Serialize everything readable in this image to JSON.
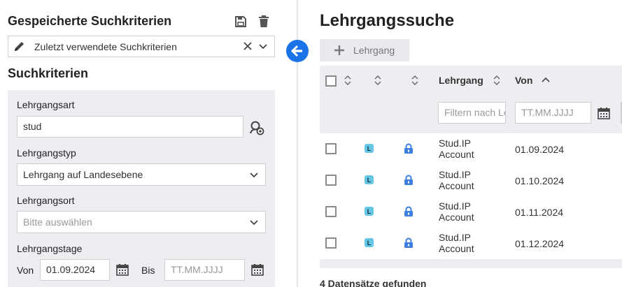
{
  "saved": {
    "title": "Gespeicherte Suchkriterien",
    "selected": "Zuletzt verwendete Suchkriterien"
  },
  "criteria": {
    "title": "Suchkriterien",
    "art_label": "Lehrgangsart",
    "art_value": "stud",
    "typ_label": "Lehrgangstyp",
    "typ_value": "Lehrgang auf Landesebene",
    "ort_label": "Lehrgangsort",
    "ort_placeholder": "Bitte auswählen",
    "tage_label": "Lehrgangstage",
    "von_label": "Von",
    "von_value": "01.09.2024",
    "bis_label": "Bis",
    "bis_placeholder": "TT.MM.JJJJ"
  },
  "main": {
    "title": "Lehrgangssuche",
    "add_label": "Lehrgang"
  },
  "table": {
    "col_lehrgang": "Lehrgang",
    "col_von": "Von",
    "filter_lehrgang_placeholder": "Filtern nach Lehrgang",
    "filter_von_placeholder": "TT.MM.JJJJ",
    "badge": "L",
    "rows": [
      {
        "lehrgang_line1": "Stud.IP",
        "lehrgang_line2": "Account",
        "von": "01.09.2024"
      },
      {
        "lehrgang_line1": "Stud.IP",
        "lehrgang_line2": "Account",
        "von": "01.10.2024"
      },
      {
        "lehrgang_line1": "Stud.IP",
        "lehrgang_line2": "Account",
        "von": "01.11.2024"
      },
      {
        "lehrgang_line1": "Stud.IP",
        "lehrgang_line2": "Account",
        "von": "01.12.2024"
      }
    ],
    "count_text": "4 Datensätze gefunden"
  },
  "colors": {
    "accent": "#1a73e8",
    "lock": "#3d7fe0",
    "badge": "#66c7e4",
    "panel": "#eceef1"
  },
  "icons": [
    "save-icon",
    "trash-icon",
    "pencil-icon",
    "close-icon",
    "chevron-down-icon",
    "search-user-icon",
    "calendar-icon",
    "arrow-left-icon",
    "plus-icon",
    "sort-icon",
    "sort-asc-icon",
    "lock-icon"
  ]
}
